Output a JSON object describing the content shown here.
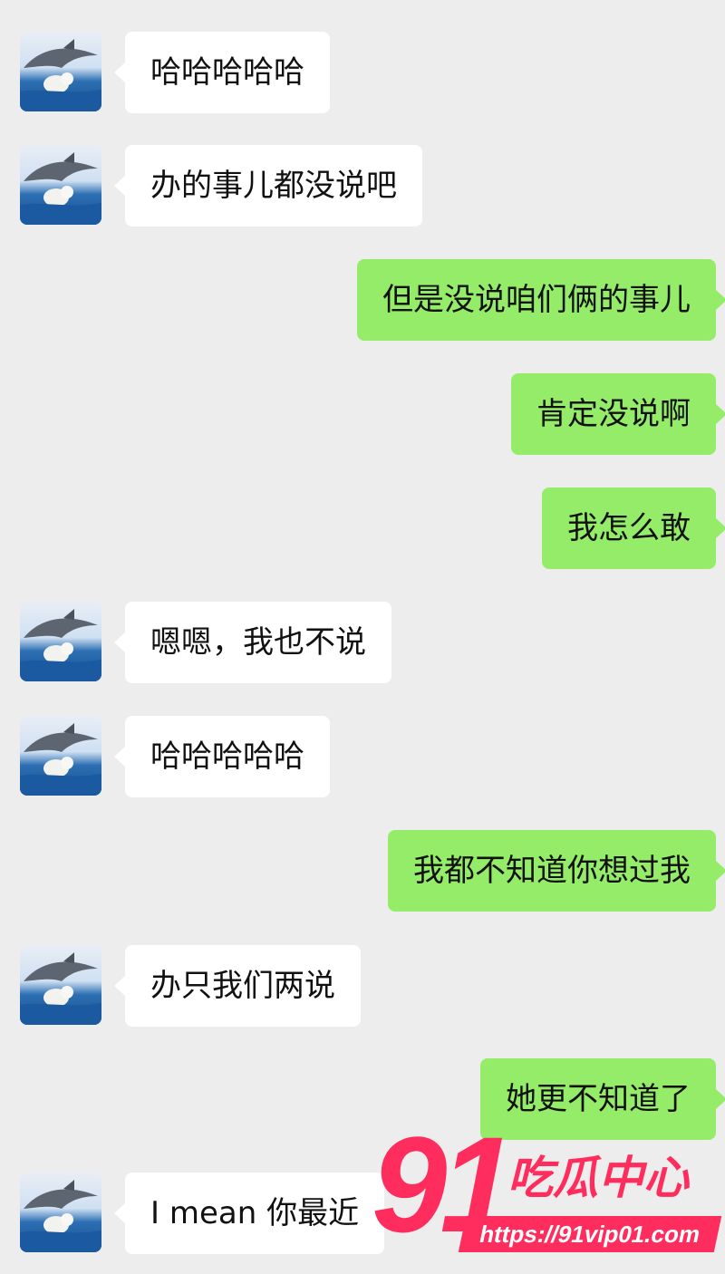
{
  "contact_avatar_icon": "dolphin-and-dog-avatar-icon",
  "colors": {
    "background": "#ededed",
    "incoming_bubble": "#ffffff",
    "outgoing_bubble": "#95ec69",
    "watermark": "#fe2d5d"
  },
  "messages": [
    {
      "side": "incoming",
      "text": "哈哈哈哈哈"
    },
    {
      "side": "incoming",
      "text": "办的事儿都没说吧"
    },
    {
      "side": "outgoing",
      "text": "但是没说咱们俩的事儿"
    },
    {
      "side": "outgoing",
      "text": "肯定没说啊"
    },
    {
      "side": "outgoing",
      "text": "我怎么敢"
    },
    {
      "side": "incoming",
      "text": "嗯嗯，我也不说"
    },
    {
      "side": "incoming",
      "text": "哈哈哈哈哈"
    },
    {
      "side": "outgoing",
      "text": "我都不知道你想过我"
    },
    {
      "side": "incoming",
      "text": "办只我们两说"
    },
    {
      "side": "outgoing",
      "text": "她更不知道了"
    },
    {
      "side": "incoming",
      "text": "I mean 你最近"
    }
  ],
  "watermark": {
    "number": "91",
    "name": "吃瓜中心",
    "url": "https://91vip01.com"
  }
}
